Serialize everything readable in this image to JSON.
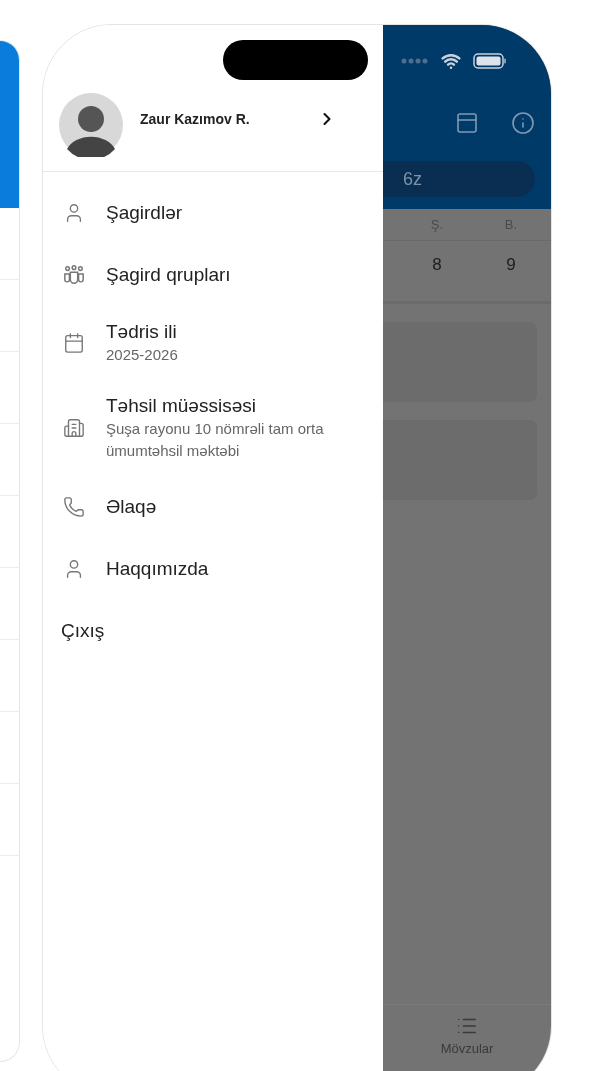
{
  "drawer": {
    "profile": {
      "name": "Zaur Kazımov R."
    },
    "items": [
      {
        "kind": "person",
        "label": "Şagirdlər"
      },
      {
        "kind": "group",
        "label": "Şagird qrupları"
      },
      {
        "kind": "calendar",
        "label": "Tədris ili",
        "subtitle": "2025-2026"
      },
      {
        "kind": "building",
        "label": "Təhsil müəssisəsi",
        "subtitle": "Şuşa rayonu 10 nömrəli tam orta ümumtəhsil məktəbi"
      },
      {
        "kind": "phone",
        "label": "Əlaqə"
      },
      {
        "kind": "person",
        "label": "Haqqımızda"
      },
      {
        "kind": "plain",
        "label": "Çıxış"
      }
    ]
  },
  "background": {
    "search": {
      "value": "6z"
    },
    "columns": [
      "Ş.",
      "B."
    ],
    "days": [
      "8",
      "9"
    ],
    "tab": {
      "label": "Mövzular"
    }
  }
}
